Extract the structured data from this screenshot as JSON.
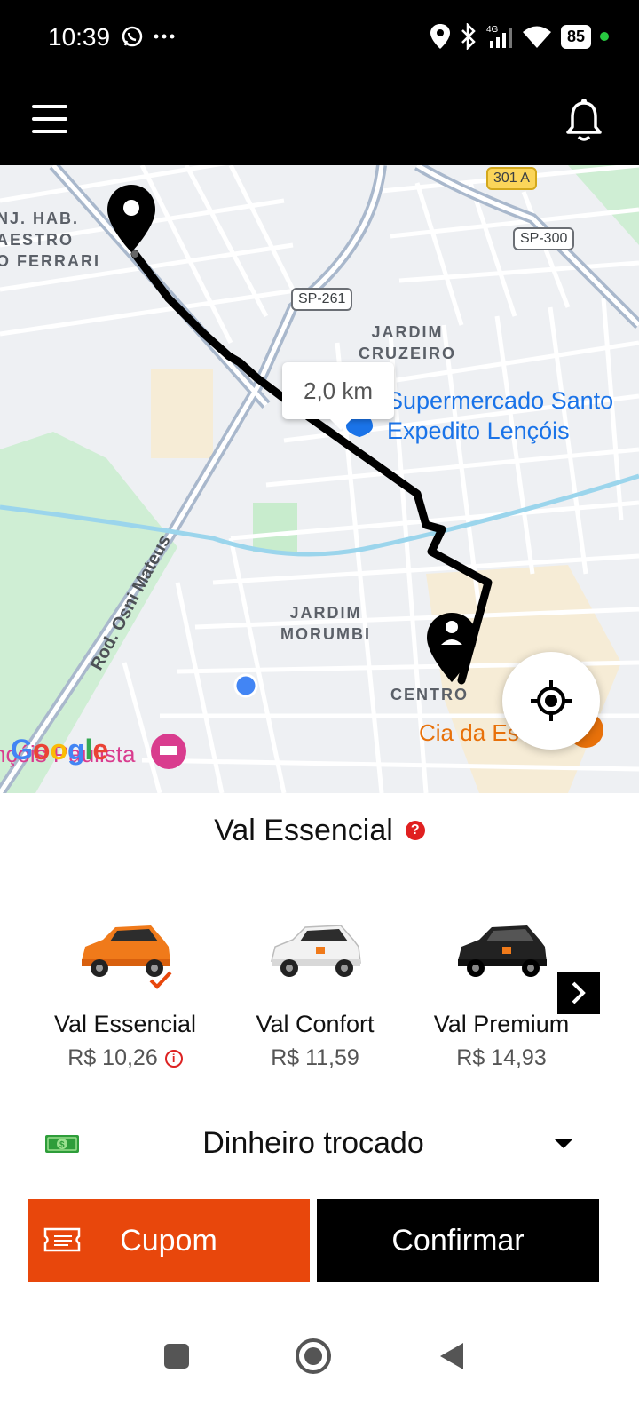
{
  "status_bar": {
    "time": "10:39",
    "battery": "85",
    "icons": [
      "whatsapp-icon",
      "more-icon",
      "location-icon",
      "bluetooth-icon",
      "signal-4g-icon",
      "wifi-icon",
      "battery-icon"
    ]
  },
  "header": {
    "menu_icon": "hamburger-menu-icon",
    "bell_icon": "bell-icon"
  },
  "map": {
    "labels": {
      "top_left": "NJ. HAB.\nAESTRO\nO FERRARI",
      "jardim_cruzeiro": "JARDIM\nCRUZEIRO",
      "jardim_morumbi": "JARDIM\nMORUMBI",
      "centro": "CENTRO"
    },
    "shields": {
      "sp261": "SP-261",
      "sp300": "SP-300",
      "r301a": "301 A"
    },
    "road_name": "Rod. Osni Mateus",
    "poi_supermarket": "Supermercado Santo\nExpedito Lençóis",
    "poi_cia": "Cia da Es",
    "poi_hotel": "nçóis Paulista",
    "distance": "2,0 km",
    "google_logo": "Google",
    "colors": {
      "route": "#000000",
      "water": "#9bd5ec",
      "park": "#c8eccd",
      "road": "#ffffff"
    }
  },
  "ride": {
    "title": "Val Essencial",
    "cars": [
      {
        "name": "Val Essencial",
        "price": "R$ 10,26",
        "color": "#f07a1a",
        "selected": true
      },
      {
        "name": "Val Confort",
        "price": "R$ 11,59",
        "color": "#f2f2f2",
        "selected": false
      },
      {
        "name": "Val Premium",
        "price": "R$ 14,93",
        "color": "#222222",
        "selected": false
      }
    ]
  },
  "payment": {
    "label": "Dinheiro trocado",
    "icon": "cash-icon"
  },
  "buttons": {
    "coupon": "Cupom",
    "confirm": "Confirmar"
  },
  "nav": [
    "square-recents-icon",
    "circle-home-icon",
    "triangle-back-icon"
  ],
  "colors": {
    "accent": "#e8470c",
    "primary": "#000000"
  }
}
